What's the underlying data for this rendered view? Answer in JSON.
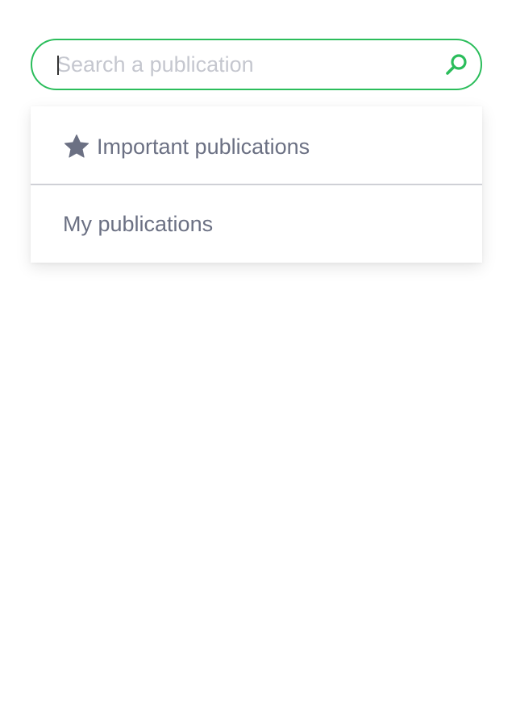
{
  "search": {
    "placeholder": "Search a publication",
    "value": "",
    "icon": "search-icon",
    "border_color": "#2bbd5b"
  },
  "dropdown": {
    "items": [
      {
        "label": "Important publications",
        "icon": "star-icon"
      },
      {
        "label": "My publications"
      }
    ]
  },
  "colors": {
    "accent": "#2bbd5b",
    "text": "#6b7083",
    "placeholder": "#c5c7cf",
    "divider": "#cfd0d6"
  }
}
